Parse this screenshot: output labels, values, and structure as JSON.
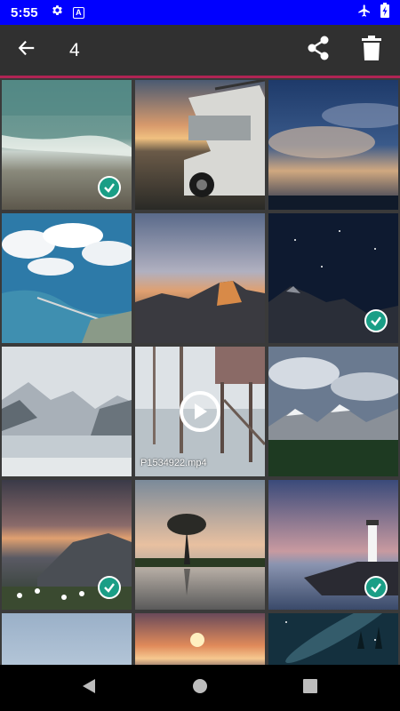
{
  "status_bar": {
    "time": "5:55",
    "icons": [
      "gear-icon",
      "a-box-icon",
      "airplane-icon",
      "battery-charging-icon"
    ],
    "background": "#0000ff"
  },
  "action_bar": {
    "selected_count": "4",
    "accent_color": "#b02454",
    "icons": [
      "back-arrow-icon",
      "share-icon",
      "delete-icon"
    ]
  },
  "grid": {
    "columns": 3,
    "items": [
      {
        "name": "beach-waves",
        "selected": true
      },
      {
        "name": "jeep-sunset",
        "selected": false
      },
      {
        "name": "cloudy-sky-dusk",
        "selected": false
      },
      {
        "name": "aerial-bay-clouds",
        "selected": false
      },
      {
        "name": "half-dome-sunset",
        "selected": false
      },
      {
        "name": "night-sky-mountains",
        "selected": true
      },
      {
        "name": "snowy-lake-mountains",
        "selected": false
      },
      {
        "name": "pier-video",
        "selected": false,
        "video": true,
        "label": "P1534922.mp4"
      },
      {
        "name": "alpine-clouds-forest",
        "selected": false
      },
      {
        "name": "mountain-sunset-flowers",
        "selected": true
      },
      {
        "name": "lone-tree-lake",
        "selected": false
      },
      {
        "name": "lighthouse-dusk",
        "selected": true
      },
      {
        "name": "pale-sky",
        "selected": false
      },
      {
        "name": "city-sunset",
        "selected": false
      },
      {
        "name": "milky-way-trees",
        "selected": false
      }
    ],
    "check_color": "#1a9e86"
  },
  "nav_bar": {
    "icons": [
      "back-triangle-icon",
      "home-circle-icon",
      "recents-square-icon"
    ]
  }
}
